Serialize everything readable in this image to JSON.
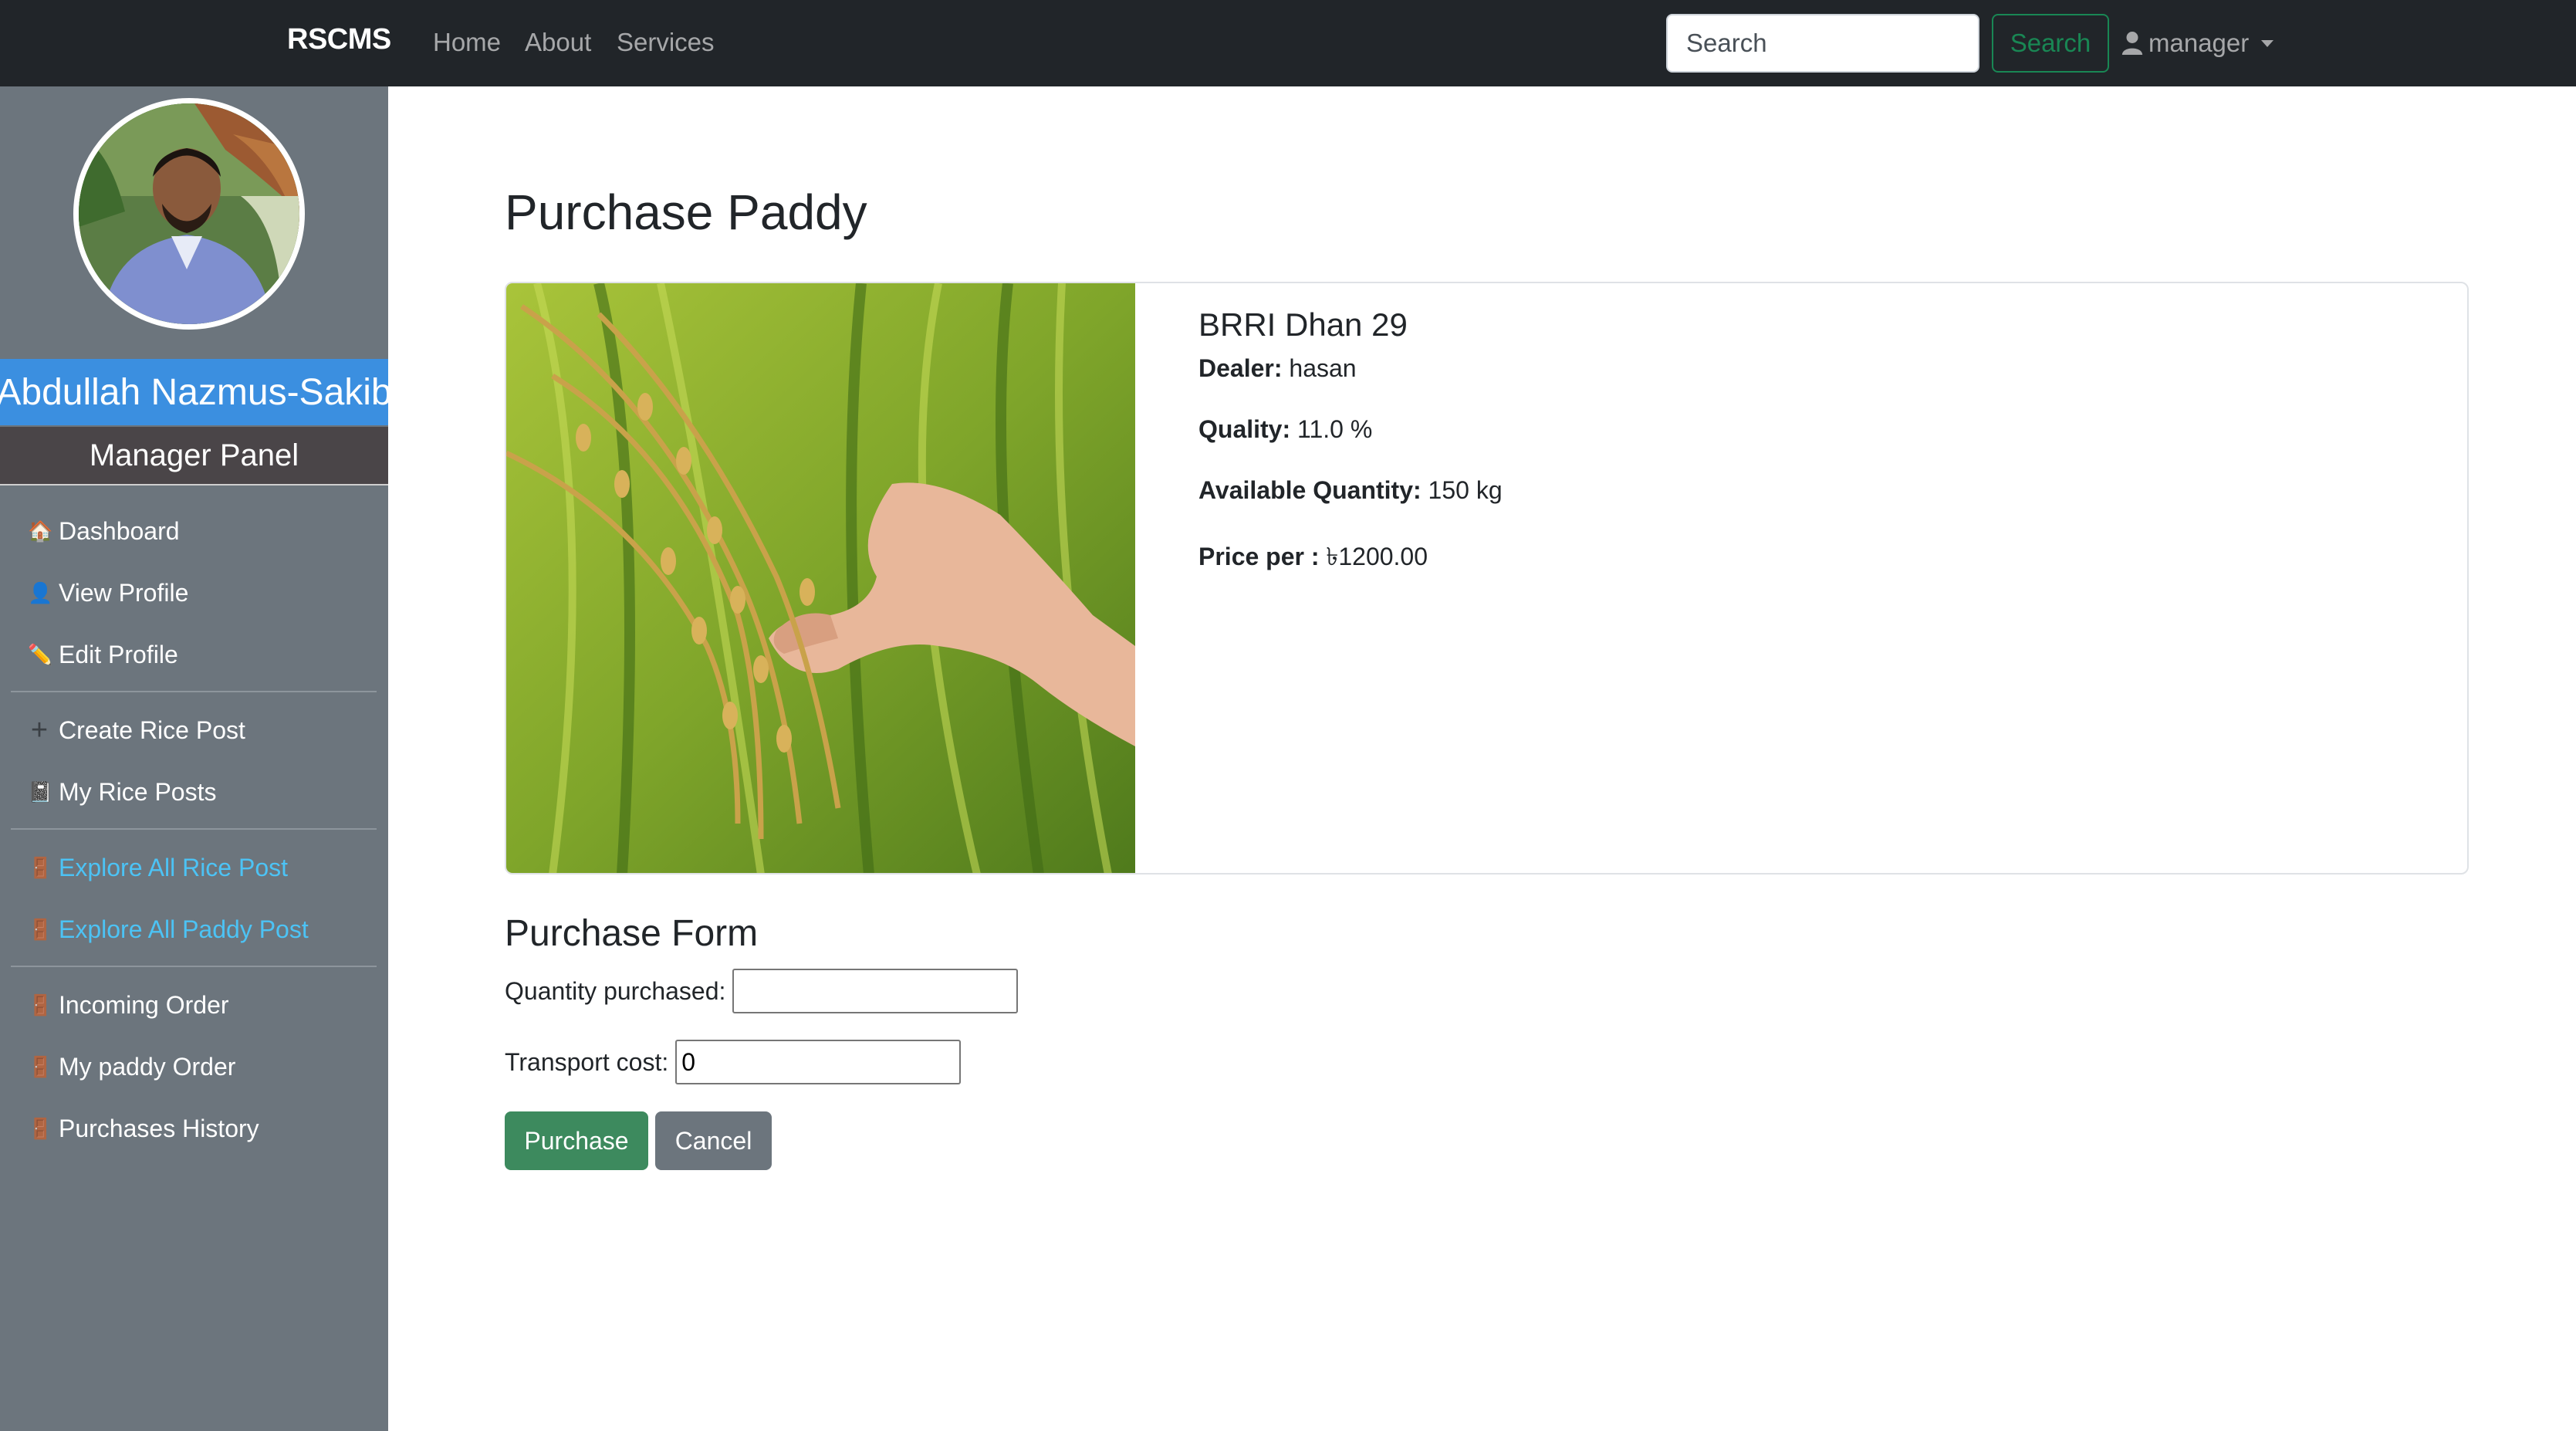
{
  "navbar": {
    "brand": "RSCMS",
    "links": [
      {
        "label": "Home"
      },
      {
        "label": "About"
      },
      {
        "label": "Services"
      }
    ],
    "search_placeholder": "Search",
    "search_button": "Search",
    "user_label": "manager"
  },
  "sidebar": {
    "user_name": "Abdullah Nazmus-Sakib",
    "panel_title": "Manager Panel",
    "items": [
      {
        "label": "Dashboard",
        "icon": "house-icon"
      },
      {
        "label": "View Profile",
        "icon": "person-icon"
      },
      {
        "label": "Edit Profile",
        "icon": "pencil-icon"
      },
      {
        "label": "Create Rice Post",
        "icon": "plus-icon"
      },
      {
        "label": "My Rice Posts",
        "icon": "notebook-icon"
      },
      {
        "label": "Explore All Rice Post",
        "icon": "door-icon"
      },
      {
        "label": "Explore All Paddy Post",
        "icon": "door-icon"
      },
      {
        "label": "Incoming Order",
        "icon": "door-icon"
      },
      {
        "label": "My paddy Order",
        "icon": "door-icon"
      },
      {
        "label": "Purchases History",
        "icon": "door-icon"
      }
    ]
  },
  "main": {
    "page_title": "Purchase Paddy",
    "product": {
      "name": "BRRI Dhan 29",
      "dealer_label": "Dealer:",
      "dealer_value": "hasan",
      "quality_label": "Quality:",
      "quality_value": "11.0 %",
      "available_label": "Available Quantity:",
      "available_value": "150 kg",
      "price_label": "Price per :",
      "price_value": "৳1200.00"
    },
    "form": {
      "title": "Purchase Form",
      "quantity_label": "Quantity purchased:",
      "quantity_value": "",
      "transport_label": "Transport cost:",
      "transport_value": "0",
      "purchase_button": "Purchase",
      "cancel_button": "Cancel"
    }
  },
  "colors": {
    "navbar_bg": "#212529",
    "sidebar_bg": "#6c757d",
    "name_banner": "#3b8fe0",
    "panel_banner": "#4a4548",
    "sidebar_link": "#4cc3f5",
    "search_green": "#198754",
    "purchase_btn": "#3d8a5e",
    "cancel_btn": "#6c757d"
  }
}
